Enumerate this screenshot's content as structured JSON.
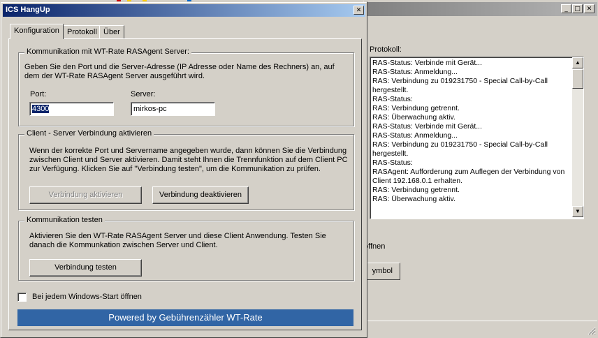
{
  "dialog": {
    "title": "ICS HangUp",
    "close_symbol": "✕",
    "tabs": [
      {
        "label": "Konfiguration",
        "active": true
      },
      {
        "label": "Protokoll",
        "active": false
      },
      {
        "label": "Über",
        "active": false
      }
    ],
    "server_group": {
      "legend": "Kommunikation mit WT-Rate RASAgent Server:",
      "description": "Geben Sie den Port und die Server-Adresse (IP Adresse oder Name des Rechners) an, auf dem der WT-Rate RASAgent Server ausgeführt wird.",
      "port_label": "Port:",
      "port_value": "4300",
      "server_label": "Server:",
      "server_value": "mirkos-pc"
    },
    "connection_group": {
      "legend": "Client - Server Verbindung aktivieren",
      "description": "Wenn der korrekte Port und Servername angegeben wurde, dann können Sie die Verbindung zwischen Client und Server aktivieren. Damit steht Ihnen die Trennfunktion auf dem Client PC zur Verfügung. Klicken Sie auf \"Verbindung testen\", um die Kommunikation zu prüfen.",
      "activate_label": "Verbindung aktivieren",
      "deactivate_label": "Verbindung deaktivieren"
    },
    "test_group": {
      "legend": "Kommunikation testen",
      "description": "Aktivieren Sie den WT-Rate RASAgent Server und diese Client Anwendung. Testen Sie danach die Kommunkation zwischen Server und Client.",
      "test_label": "Verbindung testen"
    },
    "autostart_label": "Bei jedem Windows-Start öffnen",
    "banner": "Powered by Gebührenzähler WT-Rate"
  },
  "back_window": {
    "protocol_label": "Protokoll:",
    "log_lines": [
      "RAS-Status: Verbinde mit Gerät...",
      "RAS-Status: Anmeldung...",
      "RAS: Verbindung zu 019231750 - Special Call-by-Call hergestellt.",
      "RAS-Status:",
      "RAS: Verbindung getrennt.",
      "RAS: Überwachung aktiv.",
      "RAS-Status: Verbinde mit Gerät...",
      "RAS-Status: Anmeldung...",
      "RAS: Verbindung zu 019231750 - Special Call-by-Call hergestellt.",
      "RAS-Status:",
      "RASAgent: Aufforderung zum Auflegen der Verbindung von Client 192.168.0.1 erhalten.",
      "RAS: Verbindung getrennt.",
      "RAS: Überwachung aktiv."
    ],
    "checkbox_fragment": "öffnen",
    "button_fragment": "ymbol",
    "minimize_symbol": "_",
    "maximize_symbol": "□",
    "close_symbol": "✕"
  }
}
